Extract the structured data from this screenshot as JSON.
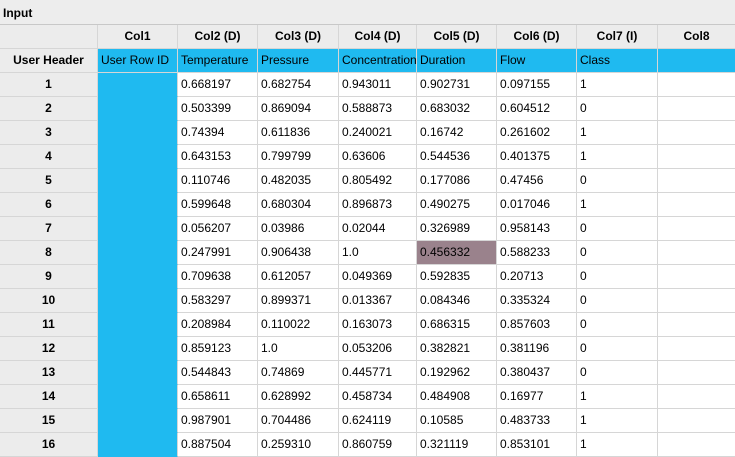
{
  "window": {
    "title": "Input"
  },
  "columns": [
    "Col1",
    "Col2 (D)",
    "Col3 (D)",
    "Col4 (D)",
    "Col5 (D)",
    "Col6 (D)",
    "Col7 (I)",
    "Col8"
  ],
  "user_header": {
    "label": "User Header",
    "values": [
      "User Row ID",
      "Temperature",
      "Pressure",
      "Concentration",
      "Duration",
      "Flow",
      "Class",
      ""
    ]
  },
  "rows": [
    {
      "label": "1",
      "values": [
        "",
        "0.668197",
        "0.682754",
        "0.943011",
        "0.902731",
        "0.097155",
        "1",
        ""
      ]
    },
    {
      "label": "2",
      "values": [
        "",
        "0.503399",
        "0.869094",
        "0.588873",
        "0.683032",
        "0.604512",
        "0",
        ""
      ]
    },
    {
      "label": "3",
      "values": [
        "",
        "0.74394",
        "0.611836",
        "0.240021",
        "0.16742",
        "0.261602",
        "1",
        ""
      ]
    },
    {
      "label": "4",
      "values": [
        "",
        "0.643153",
        "0.799799",
        "0.63606",
        "0.544536",
        "0.401375",
        "1",
        ""
      ]
    },
    {
      "label": "5",
      "values": [
        "",
        "0.110746",
        "0.482035",
        "0.805492",
        "0.177086",
        "0.47456",
        "0",
        ""
      ]
    },
    {
      "label": "6",
      "values": [
        "",
        "0.599648",
        "0.680304",
        "0.896873",
        "0.490275",
        "0.017046",
        "1",
        ""
      ]
    },
    {
      "label": "7",
      "values": [
        "",
        "0.056207",
        "0.03986",
        "0.02044",
        "0.326989",
        "0.958143",
        "0",
        ""
      ]
    },
    {
      "label": "8",
      "values": [
        "",
        "0.247991",
        "0.906438",
        "1.0",
        "0.456332",
        "0.588233",
        "0",
        ""
      ]
    },
    {
      "label": "9",
      "values": [
        "",
        "0.709638",
        "0.612057",
        "0.049369",
        "0.592835",
        "0.20713",
        "0",
        ""
      ]
    },
    {
      "label": "10",
      "values": [
        "",
        "0.583297",
        "0.899371",
        "0.013367",
        "0.084346",
        "0.335324",
        "0",
        ""
      ]
    },
    {
      "label": "11",
      "values": [
        "",
        "0.208984",
        "0.110022",
        "0.163073",
        "0.686315",
        "0.857603",
        "0",
        ""
      ]
    },
    {
      "label": "12",
      "values": [
        "",
        "0.859123",
        "1.0",
        "0.053206",
        "0.382821",
        "0.381196",
        "0",
        ""
      ]
    },
    {
      "label": "13",
      "values": [
        "",
        "0.544843",
        "0.74869",
        "0.445771",
        "0.192962",
        "0.380437",
        "0",
        ""
      ]
    },
    {
      "label": "14",
      "values": [
        "",
        "0.658611",
        "0.628992",
        "0.458734",
        "0.484908",
        "0.16977",
        "1",
        ""
      ]
    },
    {
      "label": "15",
      "values": [
        "",
        "0.987901",
        "0.704486",
        "0.624119",
        "0.10585",
        "0.483733",
        "1",
        ""
      ]
    },
    {
      "label": "16",
      "values": [
        "",
        "0.887504",
        "0.259310",
        "0.860759",
        "0.321119",
        "0.853101",
        "1",
        ""
      ]
    }
  ],
  "selection": {
    "row": 7,
    "col": 4
  },
  "colors": {
    "id_column": "#1fbaf0",
    "selected_cell": "#9a828c",
    "header_bg": "#ececec"
  }
}
